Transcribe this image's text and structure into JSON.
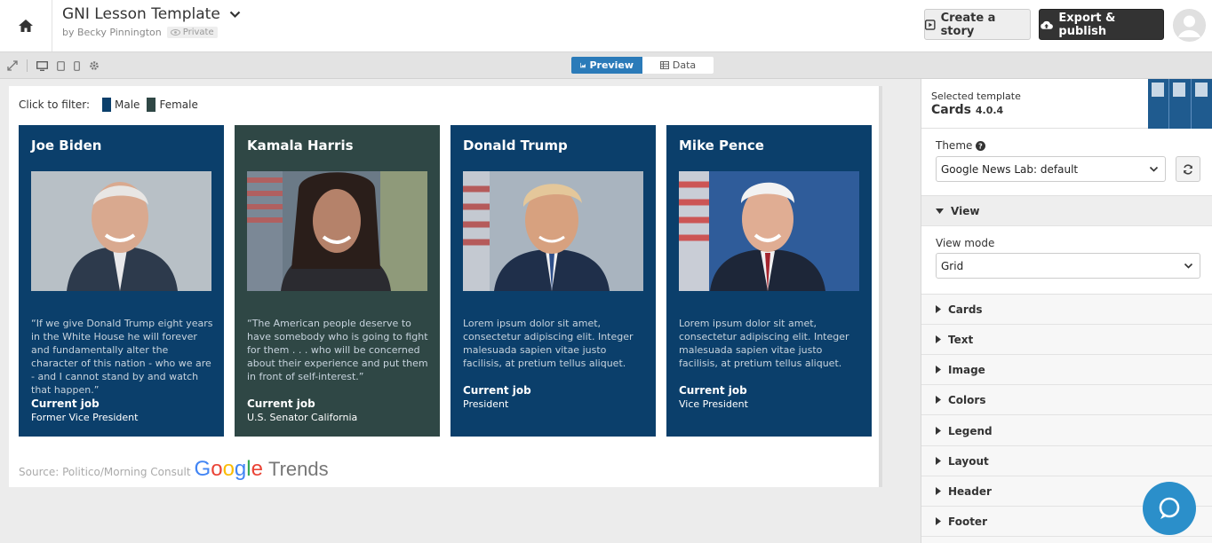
{
  "header": {
    "title": "GNI Lesson Template",
    "byline": "by Becky Pinnington",
    "privacy": "Private",
    "create_story_label": "Create a story",
    "export_label": "Export & publish"
  },
  "toolbar": {
    "preview_label": "Preview",
    "data_label": "Data"
  },
  "filter": {
    "label": "Click to filter:",
    "items": [
      {
        "label": "Male",
        "color": "#0b3f6b"
      },
      {
        "label": "Female",
        "color": "#2f4745"
      }
    ]
  },
  "cards": [
    {
      "name": "Joe Biden",
      "quote": "“If we give Donald Trump eight years in the White House he will forever and fundamentally alter the character of this nation - who we are - and I cannot stand by and watch that happen.”",
      "job_label": "Current job",
      "job": "Former Vice President",
      "bg": "#0b3f6b"
    },
    {
      "name": "Kamala Harris",
      "quote": "“The American people deserve to have somebody who is going to fight for them . . . who will be concerned about their experience and put them in front of self-interest.”",
      "job_label": "Current job",
      "job": "U.S. Senator California",
      "bg": "#2f4745"
    },
    {
      "name": "Donald Trump",
      "quote": "Lorem ipsum dolor sit amet, consectetur adipiscing elit. Integer malesuada sapien vitae justo facilisis, at pretium tellus aliquet.",
      "job_label": "Current job",
      "job": "President",
      "bg": "#0b3f6b"
    },
    {
      "name": "Mike Pence",
      "quote": "Lorem ipsum dolor sit amet, consectetur adipiscing elit. Integer malesuada sapien vitae justo facilisis, at pretium tellus aliquet.",
      "job_label": "Current job",
      "job": "Vice President",
      "bg": "#0b3f6b"
    }
  ],
  "source": {
    "text": "Source: Politico/Morning Consult",
    "logo_word": "Google",
    "logo_suffix": "Trends"
  },
  "sidebar": {
    "template_label": "Selected template",
    "template_name": "Cards",
    "template_version": "4.0.4",
    "theme_label": "Theme",
    "theme_value": "Google News Lab: default",
    "view_section": "View",
    "view_mode_label": "View mode",
    "view_mode_value": "Grid",
    "sections": [
      "Cards",
      "Text",
      "Image",
      "Colors",
      "Legend",
      "Layout",
      "Header",
      "Footer"
    ]
  },
  "colors": {
    "accent": "#2b7bb9",
    "male": "#0b3f6b",
    "female": "#2f4745"
  }
}
